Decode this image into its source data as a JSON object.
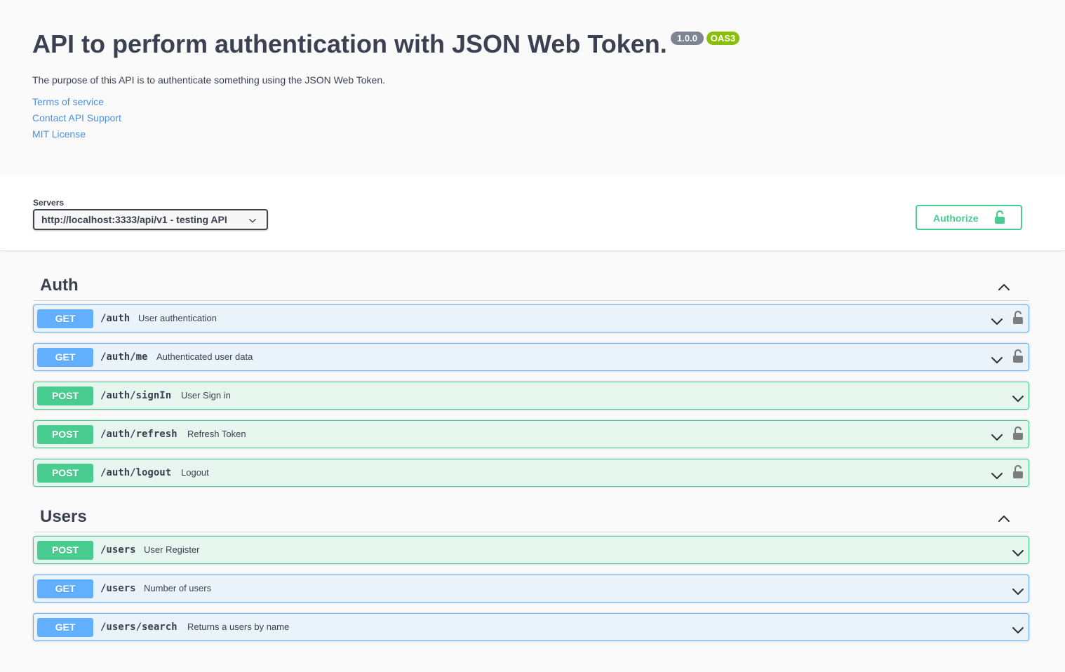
{
  "info": {
    "title": "API to perform authentication with JSON Web Token.",
    "version": "1.0.0",
    "oas": "OAS3",
    "description": "The purpose of this API is to authenticate something using the JSON Web Token.",
    "links": {
      "terms": "Terms of service",
      "contact": "Contact API Support",
      "license": "MIT License"
    }
  },
  "servers": {
    "label": "Servers",
    "selected": "http://localhost:3333/api/v1 - testing API"
  },
  "authorize": {
    "label": "Authorize"
  },
  "colors": {
    "get": "#61affe",
    "post": "#49cc90",
    "link": "#4990e2",
    "oas": "#89bf04"
  },
  "tags": [
    {
      "name": "Auth",
      "operations": [
        {
          "method": "GET",
          "path": "/auth",
          "summary": "User authentication",
          "locked": true
        },
        {
          "method": "GET",
          "path": "/auth/me",
          "summary": "Authenticated user data",
          "locked": true
        },
        {
          "method": "POST",
          "path": "/auth/signIn",
          "summary": "User Sign in",
          "locked": false
        },
        {
          "method": "POST",
          "path": "/auth/refresh",
          "summary": "Refresh Token",
          "locked": true
        },
        {
          "method": "POST",
          "path": "/auth/logout",
          "summary": "Logout",
          "locked": true
        }
      ]
    },
    {
      "name": "Users",
      "operations": [
        {
          "method": "POST",
          "path": "/users",
          "summary": "User Register",
          "locked": false
        },
        {
          "method": "GET",
          "path": "/users",
          "summary": "Number of users",
          "locked": false
        },
        {
          "method": "GET",
          "path": "/users/search",
          "summary": "Returns a users by name",
          "locked": false
        }
      ]
    }
  ]
}
